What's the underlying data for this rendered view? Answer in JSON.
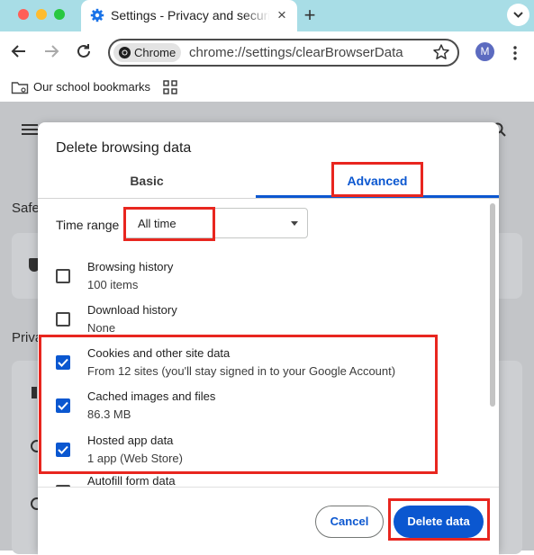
{
  "window": {
    "controls": [
      "close",
      "minimize",
      "zoom"
    ],
    "traffic_light_colors": [
      "#ff5f57",
      "#febc2e",
      "#28c840"
    ]
  },
  "tab": {
    "title": "Settings - Privacy and security",
    "icon": "settings-gear-icon"
  },
  "toolbar": {
    "chip_label": "Chrome",
    "url": "chrome://settings/clearBrowserData",
    "avatar_letter": "M"
  },
  "bookmarks": {
    "folder_label": "Our school bookmarks"
  },
  "background_page": {
    "safety_label": "Safe",
    "privacy_label": "Priva"
  },
  "dialog": {
    "title": "Delete browsing data",
    "tabs": {
      "basic": "Basic",
      "advanced": "Advanced",
      "selected": "advanced"
    },
    "time_range": {
      "label": "Time range",
      "value": "All time"
    },
    "items": [
      {
        "title": "Browsing history",
        "subtitle": "100 items",
        "checked": false
      },
      {
        "title": "Download history",
        "subtitle": "None",
        "checked": false
      },
      {
        "title": "Cookies and other site data",
        "subtitle": "From 12 sites (you'll stay signed in to your Google Account)",
        "checked": true
      },
      {
        "title": "Cached images and files",
        "subtitle": "86.3 MB",
        "checked": true
      },
      {
        "title": "Hosted app data",
        "subtitle": "1 app (Web Store)",
        "checked": true
      },
      {
        "title": "Autofill form data",
        "subtitle": "",
        "checked": false
      }
    ],
    "buttons": {
      "cancel": "Cancel",
      "delete": "Delete data"
    }
  },
  "colors": {
    "accent": "#0b57d0",
    "highlight": "#e8261f",
    "tabstrip": "#a8dde6"
  }
}
